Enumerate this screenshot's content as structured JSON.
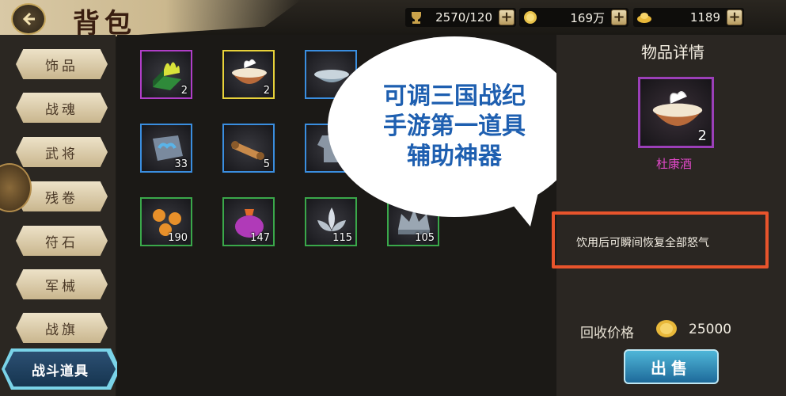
{
  "header": {
    "title": "背包",
    "resources": [
      {
        "icon": "trophy-icon",
        "value": "2570/120"
      },
      {
        "icon": "silver-coin-icon",
        "value": "169万"
      },
      {
        "icon": "gold-ingot-icon",
        "value": "1189"
      }
    ],
    "plus_label": "+"
  },
  "sidebar": {
    "tabs": [
      "饰品",
      "战魂",
      "武将",
      "残卷",
      "符石",
      "军械",
      "战旗"
    ],
    "active_tab": "战斗道具"
  },
  "inventory": {
    "items": [
      {
        "icon": "green-flame-book-icon",
        "count": "2",
        "rarity": "#b03ec8"
      },
      {
        "icon": "wine-bowl-icon",
        "count": "2",
        "rarity": "#e8d23a"
      },
      {
        "icon": "silver-bowl-icon",
        "count": "",
        "rarity": "#3a8ee0"
      },
      {
        "icon": "cloud-stone-icon",
        "count": "33",
        "rarity": "#3a8ee0"
      },
      {
        "icon": "scroll-icon",
        "count": "5",
        "rarity": "#3a8ee0"
      },
      {
        "icon": "armor-icon",
        "count": "",
        "rarity": "#3a8ee0"
      },
      {
        "icon": "orange-orbs-icon",
        "count": "190",
        "rarity": "#3aa84a"
      },
      {
        "icon": "purple-pouch-icon",
        "count": "147",
        "rarity": "#3aa84a"
      },
      {
        "icon": "silver-lotus-icon",
        "count": "115",
        "rarity": "#3aa84a"
      },
      {
        "icon": "silver-crown-icon",
        "count": "105",
        "rarity": "#3aa84a"
      }
    ]
  },
  "bubble": {
    "lines": [
      "可调三国战纪",
      "手游第一道具",
      "辅助神器"
    ]
  },
  "detail": {
    "title": "物品详情",
    "item_count": "2",
    "item_name": "杜康酒",
    "description": "饮用后可瞬间恢复全部怒气",
    "price_label": "回收价格",
    "price_value": "25000",
    "sell_label": "出售"
  },
  "colors": {
    "highlight_border": "#e8542c",
    "item_name": "#e048c8",
    "bubble_text": "#1e5fb0"
  }
}
